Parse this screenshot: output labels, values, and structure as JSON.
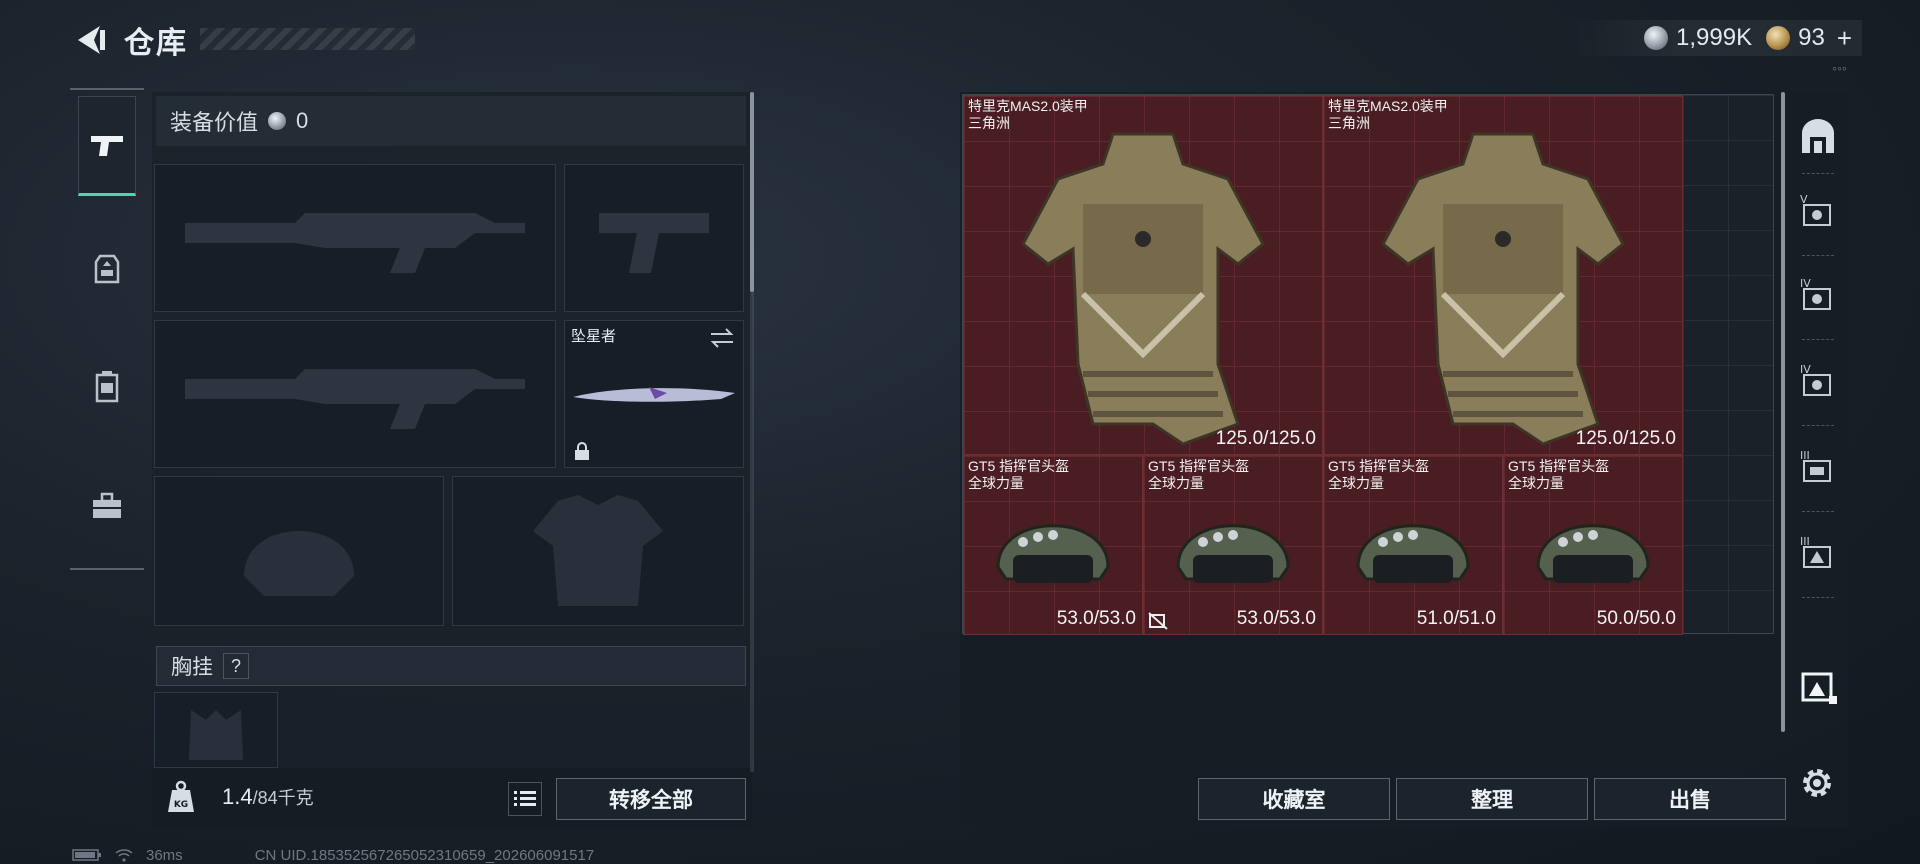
{
  "header": {
    "title": "仓库",
    "currency_silver": "1,999K",
    "currency_gold": "93",
    "currency_plus": "+"
  },
  "side_tabs": [
    "weapon-icon",
    "armor-bag-icon",
    "backpack-icon",
    "toolbox-icon"
  ],
  "loadout": {
    "value_label": "装备价值",
    "value": "0",
    "melee_name": "坠星者",
    "chest_label": "胸挂",
    "help": "?",
    "weight_current": "1.4",
    "weight_max": "/84千克",
    "transfer_all": "转移全部"
  },
  "storage": {
    "items": [
      {
        "name": "特里克MAS2.0装甲",
        "sub": "三角洲",
        "durability": "125.0/125.0",
        "kind": "armor"
      },
      {
        "name": "特里克MAS2.0装甲",
        "sub": "三角洲",
        "durability": "125.0/125.0",
        "kind": "armor"
      },
      {
        "name": "GT5 指挥官头盔",
        "sub": "全球力量",
        "durability": "53.0/53.0",
        "kind": "helmet"
      },
      {
        "name": "GT5 指挥官头盔",
        "sub": "全球力量",
        "durability": "53.0/53.0",
        "kind": "helmet"
      },
      {
        "name": "GT5 指挥官头盔",
        "sub": "全球力量",
        "durability": "51.0/51.0",
        "kind": "helmet"
      },
      {
        "name": "GT5 指挥官头盔",
        "sub": "全球力量",
        "durability": "50.0/50.0",
        "kind": "helmet"
      }
    ],
    "buttons": {
      "collection": "收藏室",
      "organize": "整理",
      "sell": "出售"
    }
  },
  "right_bar": {
    "tiers": [
      "V",
      "IV",
      "IV",
      "III",
      "III"
    ]
  },
  "status": {
    "ping": "36ms",
    "uid": "CN UID.185352567265052310659_202606091517"
  },
  "colors": {
    "accent": "#4cd6b4",
    "item_bg": "#4a1d22"
  }
}
